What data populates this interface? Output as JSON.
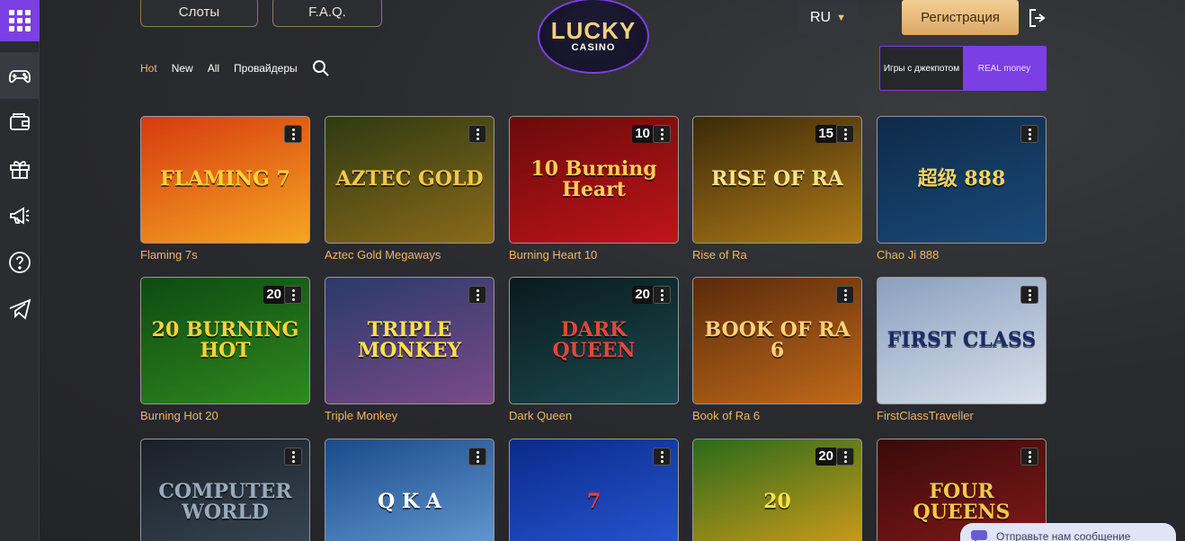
{
  "topbar": {
    "slots_label": "Слоты",
    "faq_label": "F.A.Q.",
    "logo_main": "LUCKY",
    "logo_sub": "CASINO",
    "lang": "RU",
    "register_label": "Регистрация"
  },
  "filters": {
    "hot": "Hot",
    "new": "New",
    "all": "All",
    "providers": "Провайдеры"
  },
  "mode_toggle": {
    "jackpot": "Игры с джекпотом",
    "real": "REAL money"
  },
  "games": [
    {
      "title": "Flaming 7s",
      "art": "FLAMING 7",
      "badge": "",
      "colors": [
        "#d63a0e",
        "#f5a623"
      ],
      "art_color": "#ffd23a"
    },
    {
      "title": "Aztec Gold Megaways",
      "art": "AZTEC GOLD",
      "badge": "",
      "colors": [
        "#2e3a12",
        "#8a6a1a"
      ],
      "art_color": "#f2c94c"
    },
    {
      "title": "Burning Heart 10",
      "art": "10 Burning Heart",
      "badge": "10",
      "colors": [
        "#6a0a0a",
        "#c0141a"
      ],
      "art_color": "#ffcf5a"
    },
    {
      "title": "Rise of Ra",
      "art": "RISE OF RA",
      "badge": "15",
      "colors": [
        "#3a2a08",
        "#b07a18"
      ],
      "art_color": "#ffe28a"
    },
    {
      "title": "Chao Ji 888",
      "art": "超级 888",
      "badge": "",
      "colors": [
        "#0e2a48",
        "#1a4a7a"
      ],
      "art_color": "#f4d35e"
    },
    {
      "title": "Burning Hot 20",
      "art": "20 BURNING HOT",
      "badge": "20",
      "colors": [
        "#0e4a12",
        "#2f8a1e"
      ],
      "art_color": "#ffd23a"
    },
    {
      "title": "Triple Monkey",
      "art": "TRIPLE MONKEY",
      "badge": "",
      "colors": [
        "#2a3a6a",
        "#7a4a8a"
      ],
      "art_color": "#ffe14a"
    },
    {
      "title": "Dark Queen",
      "art": "DARK QUEEN",
      "badge": "20",
      "colors": [
        "#0a1a1e",
        "#1a4a4e"
      ],
      "art_color": "#e0483a"
    },
    {
      "title": "Book of Ra 6",
      "art": "BOOK OF RA 6",
      "badge": "",
      "colors": [
        "#5a2a0a",
        "#c06a1a"
      ],
      "art_color": "#ffd27a"
    },
    {
      "title": "FirstClassTraveller",
      "art": "FIRST CLASS",
      "badge": "",
      "colors": [
        "#8aa0c0",
        "#d8e0ea"
      ],
      "art_color": "#1a2a6a"
    },
    {
      "title": "",
      "art": "COMPUTER WORLD",
      "badge": "",
      "colors": [
        "#1a2028",
        "#3a4a58"
      ],
      "art_color": "#9ab"
    },
    {
      "title": "",
      "art": "Q K A",
      "badge": "",
      "colors": [
        "#1a4a8a",
        "#6aa0d8"
      ],
      "art_color": "#ffffff"
    },
    {
      "title": "",
      "art": "7",
      "badge": "",
      "colors": [
        "#0a2a8a",
        "#2a5ad8"
      ],
      "art_color": "#ff3a3a"
    },
    {
      "title": "",
      "art": "20",
      "badge": "20",
      "colors": [
        "#2a6a1a",
        "#e0a01a"
      ],
      "art_color": "#ffe14a"
    },
    {
      "title": "",
      "art": "FOUR QUEENS",
      "badge": "",
      "colors": [
        "#3a0a0a",
        "#8a1a1a"
      ],
      "art_color": "#f2c94c"
    }
  ],
  "chat": {
    "label": "Отправьте нам сообщение"
  }
}
